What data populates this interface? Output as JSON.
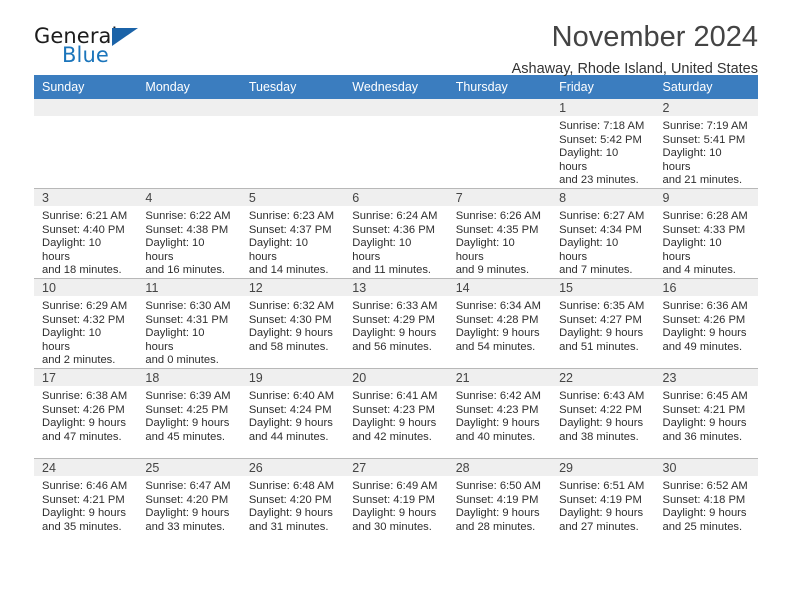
{
  "brand": {
    "name_part1": "General",
    "name_part2": "Blue",
    "triangle_color": "#1b63a8",
    "blue_color": "#1b75bb"
  },
  "header": {
    "title": "November 2024",
    "location": "Ashaway, Rhode Island, United States"
  },
  "theme": {
    "header_blue": "#3b7dbf",
    "band_gray": "#efefef",
    "row_border": "#b8b8b8"
  },
  "weekday_headers": [
    "Sunday",
    "Monday",
    "Tuesday",
    "Wednesday",
    "Thursday",
    "Friday",
    "Saturday"
  ],
  "weeks": [
    [
      {
        "day": "",
        "sunrise": "",
        "sunset": "",
        "daylight_line1": "",
        "daylight_line2": ""
      },
      {
        "day": "",
        "sunrise": "",
        "sunset": "",
        "daylight_line1": "",
        "daylight_line2": ""
      },
      {
        "day": "",
        "sunrise": "",
        "sunset": "",
        "daylight_line1": "",
        "daylight_line2": ""
      },
      {
        "day": "",
        "sunrise": "",
        "sunset": "",
        "daylight_line1": "",
        "daylight_line2": ""
      },
      {
        "day": "",
        "sunrise": "",
        "sunset": "",
        "daylight_line1": "",
        "daylight_line2": ""
      },
      {
        "day": "1",
        "sunrise": "Sunrise: 7:18 AM",
        "sunset": "Sunset: 5:42 PM",
        "daylight_line1": "Daylight: 10 hours",
        "daylight_line2": "and 23 minutes."
      },
      {
        "day": "2",
        "sunrise": "Sunrise: 7:19 AM",
        "sunset": "Sunset: 5:41 PM",
        "daylight_line1": "Daylight: 10 hours",
        "daylight_line2": "and 21 minutes."
      }
    ],
    [
      {
        "day": "3",
        "sunrise": "Sunrise: 6:21 AM",
        "sunset": "Sunset: 4:40 PM",
        "daylight_line1": "Daylight: 10 hours",
        "daylight_line2": "and 18 minutes."
      },
      {
        "day": "4",
        "sunrise": "Sunrise: 6:22 AM",
        "sunset": "Sunset: 4:38 PM",
        "daylight_line1": "Daylight: 10 hours",
        "daylight_line2": "and 16 minutes."
      },
      {
        "day": "5",
        "sunrise": "Sunrise: 6:23 AM",
        "sunset": "Sunset: 4:37 PM",
        "daylight_line1": "Daylight: 10 hours",
        "daylight_line2": "and 14 minutes."
      },
      {
        "day": "6",
        "sunrise": "Sunrise: 6:24 AM",
        "sunset": "Sunset: 4:36 PM",
        "daylight_line1": "Daylight: 10 hours",
        "daylight_line2": "and 11 minutes."
      },
      {
        "day": "7",
        "sunrise": "Sunrise: 6:26 AM",
        "sunset": "Sunset: 4:35 PM",
        "daylight_line1": "Daylight: 10 hours",
        "daylight_line2": "and 9 minutes."
      },
      {
        "day": "8",
        "sunrise": "Sunrise: 6:27 AM",
        "sunset": "Sunset: 4:34 PM",
        "daylight_line1": "Daylight: 10 hours",
        "daylight_line2": "and 7 minutes."
      },
      {
        "day": "9",
        "sunrise": "Sunrise: 6:28 AM",
        "sunset": "Sunset: 4:33 PM",
        "daylight_line1": "Daylight: 10 hours",
        "daylight_line2": "and 4 minutes."
      }
    ],
    [
      {
        "day": "10",
        "sunrise": "Sunrise: 6:29 AM",
        "sunset": "Sunset: 4:32 PM",
        "daylight_line1": "Daylight: 10 hours",
        "daylight_line2": "and 2 minutes."
      },
      {
        "day": "11",
        "sunrise": "Sunrise: 6:30 AM",
        "sunset": "Sunset: 4:31 PM",
        "daylight_line1": "Daylight: 10 hours",
        "daylight_line2": "and 0 minutes."
      },
      {
        "day": "12",
        "sunrise": "Sunrise: 6:32 AM",
        "sunset": "Sunset: 4:30 PM",
        "daylight_line1": "Daylight: 9 hours",
        "daylight_line2": "and 58 minutes."
      },
      {
        "day": "13",
        "sunrise": "Sunrise: 6:33 AM",
        "sunset": "Sunset: 4:29 PM",
        "daylight_line1": "Daylight: 9 hours",
        "daylight_line2": "and 56 minutes."
      },
      {
        "day": "14",
        "sunrise": "Sunrise: 6:34 AM",
        "sunset": "Sunset: 4:28 PM",
        "daylight_line1": "Daylight: 9 hours",
        "daylight_line2": "and 54 minutes."
      },
      {
        "day": "15",
        "sunrise": "Sunrise: 6:35 AM",
        "sunset": "Sunset: 4:27 PM",
        "daylight_line1": "Daylight: 9 hours",
        "daylight_line2": "and 51 minutes."
      },
      {
        "day": "16",
        "sunrise": "Sunrise: 6:36 AM",
        "sunset": "Sunset: 4:26 PM",
        "daylight_line1": "Daylight: 9 hours",
        "daylight_line2": "and 49 minutes."
      }
    ],
    [
      {
        "day": "17",
        "sunrise": "Sunrise: 6:38 AM",
        "sunset": "Sunset: 4:26 PM",
        "daylight_line1": "Daylight: 9 hours",
        "daylight_line2": "and 47 minutes."
      },
      {
        "day": "18",
        "sunrise": "Sunrise: 6:39 AM",
        "sunset": "Sunset: 4:25 PM",
        "daylight_line1": "Daylight: 9 hours",
        "daylight_line2": "and 45 minutes."
      },
      {
        "day": "19",
        "sunrise": "Sunrise: 6:40 AM",
        "sunset": "Sunset: 4:24 PM",
        "daylight_line1": "Daylight: 9 hours",
        "daylight_line2": "and 44 minutes."
      },
      {
        "day": "20",
        "sunrise": "Sunrise: 6:41 AM",
        "sunset": "Sunset: 4:23 PM",
        "daylight_line1": "Daylight: 9 hours",
        "daylight_line2": "and 42 minutes."
      },
      {
        "day": "21",
        "sunrise": "Sunrise: 6:42 AM",
        "sunset": "Sunset: 4:23 PM",
        "daylight_line1": "Daylight: 9 hours",
        "daylight_line2": "and 40 minutes."
      },
      {
        "day": "22",
        "sunrise": "Sunrise: 6:43 AM",
        "sunset": "Sunset: 4:22 PM",
        "daylight_line1": "Daylight: 9 hours",
        "daylight_line2": "and 38 minutes."
      },
      {
        "day": "23",
        "sunrise": "Sunrise: 6:45 AM",
        "sunset": "Sunset: 4:21 PM",
        "daylight_line1": "Daylight: 9 hours",
        "daylight_line2": "and 36 minutes."
      }
    ],
    [
      {
        "day": "24",
        "sunrise": "Sunrise: 6:46 AM",
        "sunset": "Sunset: 4:21 PM",
        "daylight_line1": "Daylight: 9 hours",
        "daylight_line2": "and 35 minutes."
      },
      {
        "day": "25",
        "sunrise": "Sunrise: 6:47 AM",
        "sunset": "Sunset: 4:20 PM",
        "daylight_line1": "Daylight: 9 hours",
        "daylight_line2": "and 33 minutes."
      },
      {
        "day": "26",
        "sunrise": "Sunrise: 6:48 AM",
        "sunset": "Sunset: 4:20 PM",
        "daylight_line1": "Daylight: 9 hours",
        "daylight_line2": "and 31 minutes."
      },
      {
        "day": "27",
        "sunrise": "Sunrise: 6:49 AM",
        "sunset": "Sunset: 4:19 PM",
        "daylight_line1": "Daylight: 9 hours",
        "daylight_line2": "and 30 minutes."
      },
      {
        "day": "28",
        "sunrise": "Sunrise: 6:50 AM",
        "sunset": "Sunset: 4:19 PM",
        "daylight_line1": "Daylight: 9 hours",
        "daylight_line2": "and 28 minutes."
      },
      {
        "day": "29",
        "sunrise": "Sunrise: 6:51 AM",
        "sunset": "Sunset: 4:19 PM",
        "daylight_line1": "Daylight: 9 hours",
        "daylight_line2": "and 27 minutes."
      },
      {
        "day": "30",
        "sunrise": "Sunrise: 6:52 AM",
        "sunset": "Sunset: 4:18 PM",
        "daylight_line1": "Daylight: 9 hours",
        "daylight_line2": "and 25 minutes."
      }
    ]
  ]
}
